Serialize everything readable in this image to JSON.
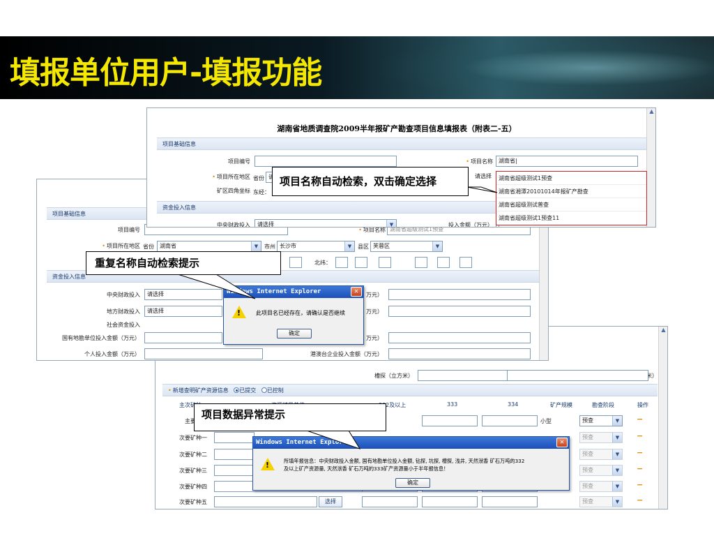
{
  "slide": {
    "title": "填报单位用户-填报功能"
  },
  "form1": {
    "heading": "湖南省地质调查院2009半年报矿产勘查项目信息填报表（附表二-五）",
    "section_basic": "项目基础信息",
    "label_project_no": "项目编号",
    "label_project_name": "项目名称",
    "project_name_value": "湖南省|",
    "label_location": "项目所在地区",
    "province_prefix": "省份",
    "province_value": "请",
    "city_select_value": "请选择",
    "label_coords": "矿区四角坐标",
    "east_prefix": "东经：",
    "section_fund": "资金投入信息",
    "label_central_fund": "中央财政投入",
    "central_fund_value": "请选择",
    "label_invest_amount": "投入金额（万元）"
  },
  "dropdown": {
    "options": [
      "湖南省超级测试1预查",
      "湖南省湘潭20101014年报矿产勘查",
      "湖南省超级测试普查",
      "湖南省超级测试1预查11"
    ]
  },
  "form2": {
    "section_basic": "项目基础信息",
    "label_project_no": "项目编号",
    "label_project_name": "项目名称",
    "project_name_value": "湖南省超级测试1预查",
    "label_location": "项目所在地区",
    "province_prefix": "省份",
    "province_value": "湖南省",
    "city_prefix": "市州",
    "city_value": "长沙市",
    "county_prefix": "县区",
    "county_value": "芙蓉区",
    "north_prefix": "北纬：",
    "section_fund": "资金投入信息",
    "label_central_fund": "中央财政投入",
    "central_fund_value": "请选择",
    "label_local_fund": "地方财政投入",
    "local_fund_value": "请选择",
    "label_social_fund": "社会资金投入",
    "label_state_owned": "国有地勘单位投入金额（万元）",
    "label_personal": "个人投入金额（万元）",
    "label_hk_macao": "港澳台企业投入金额（万元）",
    "unit_suffix": "万元）"
  },
  "dialog1": {
    "title": "Windows Internet Explorer",
    "message": "此项目名已经存在，请确认是否继续",
    "ok_label": "确定"
  },
  "form3": {
    "label_trench": "槽探（立方米）",
    "label_shallow_well": "浅井（米）",
    "new_mineral_link": "新增查明矿产资源信息",
    "radio_submitted": "已提交",
    "radio_controlled": "已控制",
    "col_main_mineral": "主次矿种",
    "col_resource_unit": "资源储量单位",
    "col_332_above": "332及以上",
    "col_333": "333",
    "col_334": "334",
    "col_scale": "矿产规模",
    "col_stage": "勘查阶段",
    "col_action": "操作",
    "row_main": "主要矿种",
    "rows": [
      "次要矿种一",
      "次要矿种二",
      "次要矿种三",
      "次要矿种四",
      "次要矿种五"
    ],
    "scale_value": "小型",
    "stage_value": "预查",
    "select_button": "选择",
    "minus_symbol": "−"
  },
  "dialog2": {
    "title": "Windows Internet Explorer",
    "message_line1": "所填年报信息：中央财政投入金额, 国有地勘单位投入金额, 钻探, 坑探, 槽探, 浅井, 天然洑香  矿石万吨的332",
    "message_line2": "及以上矿产资源量, 天然洑香  矿石万吨的333矿产资源量小于半年报信息！",
    "ok_label": "确定"
  },
  "callouts": {
    "auto_search": "项目名称自动检索，双击确定选择",
    "duplicate": "重复名称自动检索提示",
    "abnormal": "项目数据异常提示"
  }
}
